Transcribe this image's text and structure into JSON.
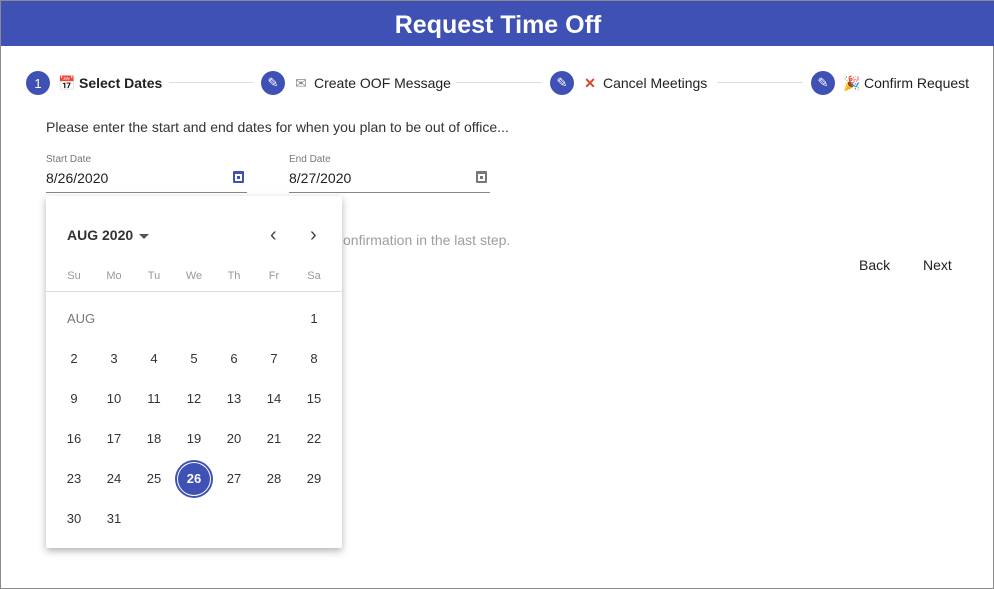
{
  "title": "Request Time Off",
  "steps": [
    {
      "marker": "1",
      "icon": "calendar-icon",
      "emoji": "📅",
      "label": "Select Dates"
    },
    {
      "marker": "edit",
      "icon": "envelope-icon",
      "emoji": "✉",
      "label": "Create OOF Message"
    },
    {
      "marker": "edit",
      "icon": "cross-mark-icon",
      "emoji": "❌",
      "label": "Cancel Meetings"
    },
    {
      "marker": "edit",
      "icon": "party-popper-icon",
      "emoji": "🎉",
      "label": "Confirm Request"
    }
  ],
  "intro": "Please enter the start and end dates for when you plan to be out of office...",
  "start_date": {
    "label": "Start Date",
    "value": "8/26/2020"
  },
  "end_date": {
    "label": "End Date",
    "value": "8/27/2020"
  },
  "hint_fragment": "onfirmation in the last step.",
  "buttons": {
    "back": "Back",
    "next": "Next"
  },
  "picker": {
    "month_year": "AUG 2020",
    "month_label": "AUG",
    "weekdays": [
      "Su",
      "Mo",
      "Tu",
      "We",
      "Th",
      "Fr",
      "Sa"
    ],
    "selected_day": 26,
    "days_in_month": 31,
    "first_weekday": 6,
    "accent": "#3f51b5"
  }
}
